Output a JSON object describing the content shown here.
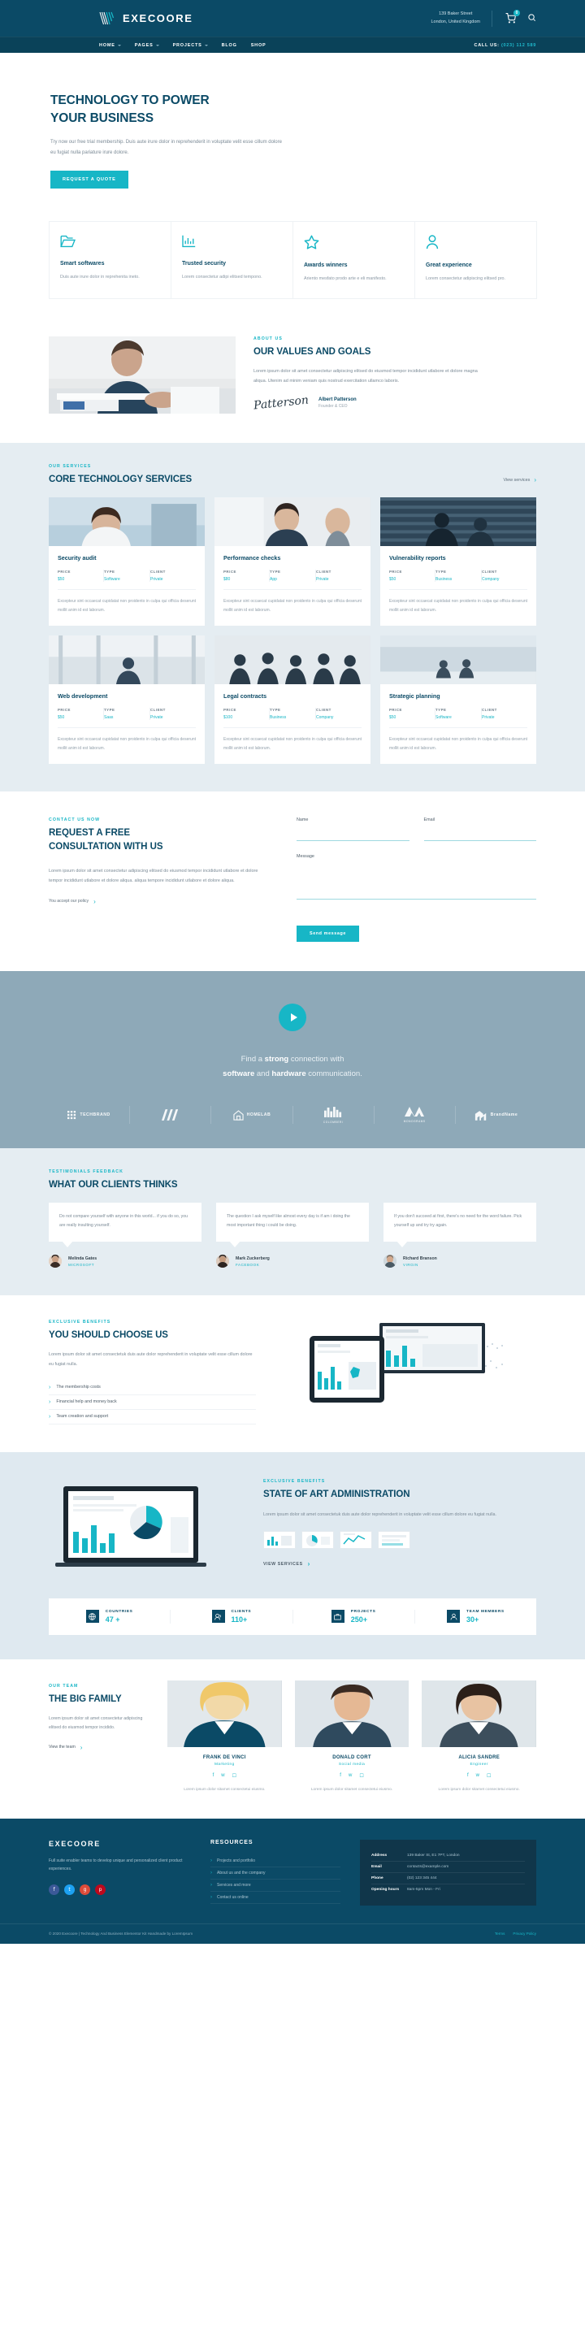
{
  "header": {
    "brand": "EXECOORE",
    "address_line1": "139 Baker Street",
    "address_line2": "London, United Kingdom",
    "cart_count": "0",
    "cart_icon": "shopping-cart-icon",
    "search_icon": "search-icon"
  },
  "nav": {
    "items": [
      {
        "label": "HOME",
        "has_caret": true
      },
      {
        "label": "PAGES",
        "has_caret": true
      },
      {
        "label": "PROJECTS",
        "has_caret": true
      },
      {
        "label": "BLOG",
        "has_caret": false
      },
      {
        "label": "SHOP",
        "has_caret": false
      }
    ],
    "call_label": "CALL US:",
    "call_number": "(023) 112 589"
  },
  "hero": {
    "title_line1": "TECHNOLOGY TO POWER",
    "title_line2": "YOUR BUSINESS",
    "subtitle": "Try now our free trial membership. Duis aute irure dolor in reprehenderit in voluptate velit esse cillum dolore eu fugiat nulla pariature irure dolore.",
    "cta": "REQUEST A QUOTE"
  },
  "features": [
    {
      "icon": "folder-icon",
      "title": "Smart softwares",
      "text": "Duis aute irure dolor in reprehenita ineto."
    },
    {
      "icon": "bar-chart-icon",
      "title": "Trusted security",
      "text": "Lorem consectetur adipi elitsed tempono."
    },
    {
      "icon": "star-icon",
      "title": "Awards winners",
      "text": "Ariento mesfato prodo arte e eli manifesto."
    },
    {
      "icon": "user-icon",
      "title": "Great experience",
      "text": "Lorem consectetur adipiscing elitsed pro."
    }
  ],
  "about": {
    "eyebrow": "ABOUT US",
    "title": "OUR VALUES AND GOALS",
    "text": "Lorem ipsum dolor sit amet consectetur adipiscing elitsed do eiusmod tempor incididunt utlabore et dolore magna aliqua. Utenim ad minim veniam quis nostrud exercitation ullamco laboris.",
    "signature": "Patterson",
    "name": "Albert Patterson",
    "role": "Founder & CEO"
  },
  "services": {
    "eyebrow": "OUR SERVICES",
    "title": "CORE TECHNOLOGY SERVICES",
    "view_link": "View services",
    "meta_keys": {
      "price": "PRICE",
      "type": "TYPE",
      "client": "CLIENT"
    },
    "desc": "Excepteur sint occaecat cupidatat non proidento in culpa qui officia deserunt mollit anim id est laborum.",
    "cards": [
      {
        "title": "Security audit",
        "price": "$50",
        "type": "Software",
        "client": "Private"
      },
      {
        "title": "Performance checks",
        "price": "$80",
        "type": "App",
        "client": "Private"
      },
      {
        "title": "Vulnerability reports",
        "price": "$50",
        "type": "Business",
        "client": "Company"
      },
      {
        "title": "Web development",
        "price": "$50",
        "type": "Saas",
        "client": "Private"
      },
      {
        "title": "Legal contracts",
        "price": "$100",
        "type": "Business",
        "client": "Company"
      },
      {
        "title": "Strategic planning",
        "price": "$50",
        "type": "Software",
        "client": "Private"
      }
    ]
  },
  "contact": {
    "eyebrow": "CONTACT US NOW",
    "title_line1": "REQUEST A FREE",
    "title_line2": "CONSULTATION WITH US",
    "text": "Lorem ipsum dolor sit amet consectetur adipiscing elitsed do eiusmod tempor incididunt utlabore et dolore tempor incididunt utlabore et dolore aliqua. aliqua tempore incididunt utlabore et dolore aliqua.",
    "policy": "You accept our policy",
    "name_label": "Name",
    "email_label": "Email",
    "message_label": "Message",
    "name_value": "",
    "email_value": "",
    "message_value": "",
    "submit": "Send message"
  },
  "video_cta": {
    "play_icon": "play-icon",
    "line1_a": "Find a ",
    "line1_b": "strong",
    "line1_c": " connection with",
    "line2_a": "software",
    "line2_b": " and ",
    "line2_c": "hardware",
    "line2_d": " communication.",
    "logos": [
      {
        "name": "TECHBRAND",
        "sub": ""
      },
      {
        "name": "",
        "sub": ""
      },
      {
        "name": "HOMELAB",
        "sub": ""
      },
      {
        "name": "",
        "sub": "COLOMBERI"
      },
      {
        "name": "",
        "sub": "MONOGRAMS"
      },
      {
        "name": "BrandName",
        "sub": ""
      }
    ]
  },
  "testimonials": {
    "eyebrow": "TESTIMONIALS FEEDBACK",
    "title": "WHAT OUR CLIENTS THINKS",
    "items": [
      {
        "quote": "Do not compare yourself with anyone in this world... if you do so, you are really insulting yourself.",
        "name": "Melinda Gates",
        "company": "MICROSOFT"
      },
      {
        "quote": "The question I ask myself like almost every day is if am i doing the most important thing i could be doing.",
        "name": "Mark Zuckerberg",
        "company": "FACEBOOK"
      },
      {
        "quote": "If you don't succeed at first, there's no need for the word failure. Pick yourself up and try try again.",
        "name": "Richard Branson",
        "company": "VIRGIN"
      }
    ]
  },
  "benefits": {
    "eyebrow": "EXCLUSIVE BENEFITS",
    "title": "YOU SHOULD CHOOSE US",
    "text": "Lorem ipsum dolor sit amet consectetuk duis aute dolor reprehenderit in voluptate velit esse cillum dolore eu fugiat nulla.",
    "list": [
      "The membership costs",
      "Financial help and money back",
      "Team creation and support"
    ]
  },
  "admin": {
    "eyebrow": "EXCLUSIVE BENEFITS",
    "title": "STATE OF ART ADMINISTRATION",
    "text": "Lorem ipsum dolor sit amet consectetuk duis aute dolor reprehenderit in voluptate velit esse cillum dolore eu fugiat nulla.",
    "cta": "VIEW SERVICES"
  },
  "stats": [
    {
      "icon": "globe-icon",
      "label": "COUNTRIES",
      "value": "47 +"
    },
    {
      "icon": "users-icon",
      "label": "CLIENTS",
      "value": "110+"
    },
    {
      "icon": "briefcase-icon",
      "label": "PROJECTS",
      "value": "250+"
    },
    {
      "icon": "team-icon",
      "label": "TEAM MEMBERS",
      "value": "30+"
    }
  ],
  "team": {
    "eyebrow": "OUR TEAM",
    "title": "THE BIG FAMILY",
    "text": "Lorem ipsum dolor sit amet consectetur adipiscing elitsed do eiusmod tempor incidido.",
    "link": "View the team",
    "members": [
      {
        "name": "FRANK DE VINCI",
        "role": "Marketing",
        "text": "Lorem ipsum dolor sitamet consectetui eiusmo."
      },
      {
        "name": "DONALD CORT",
        "role": "Social media",
        "text": "Lorem ipsum dolor sitamet consectetui eiusmo."
      },
      {
        "name": "ALICIA SANDRE",
        "role": "Engineer",
        "text": "Lorem ipsum dolor sitamet consectetui eiusmo."
      }
    ],
    "social_icons": [
      "facebook-icon",
      "twitter-icon",
      "instagram-icon"
    ]
  },
  "footer": {
    "brand": "EXECOORE",
    "about": "Full suite enabler teams to develop unique and personalized client product experiences.",
    "social": [
      {
        "icon": "facebook-icon",
        "glyph": "f",
        "color": "#3b5998"
      },
      {
        "icon": "twitter-icon",
        "glyph": "t",
        "color": "#1da1f2"
      },
      {
        "icon": "google-icon",
        "glyph": "g",
        "color": "#dd4b39"
      },
      {
        "icon": "pinterest-icon",
        "glyph": "p",
        "color": "#bd081c"
      }
    ],
    "resources_title": "RESOURCES",
    "resources": [
      "Projects and portfolio",
      "About us and the company",
      "Services and more",
      "Contact us online"
    ],
    "contact_rows": [
      {
        "k": "Address",
        "v": "139 Baker St, E1 7PT, London"
      },
      {
        "k": "Email",
        "v": "contacts@example.com"
      },
      {
        "k": "Phone",
        "v": "(02) 123 345 444"
      },
      {
        "k": "Opening hours",
        "v": "8am-5pm Mon - Fri"
      }
    ],
    "copyright": "© 2020 Execoore | Technology And Business Elementor Kit Handmade by LoremIpsum",
    "bottom_links": [
      "Terms",
      "Privacy Policy"
    ]
  },
  "colors": {
    "navy": "#0b4a66",
    "teal": "#17b6c6",
    "light": "#e5edf2",
    "slate": "#8ea9b8"
  }
}
